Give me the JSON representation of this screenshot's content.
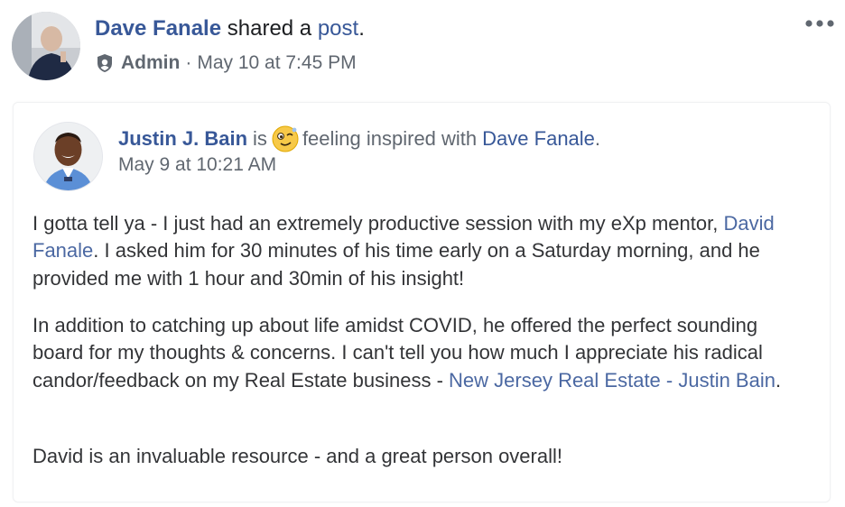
{
  "header": {
    "author": "Dave Fanale",
    "shared_text": "shared a",
    "post_link": "post",
    "period": ".",
    "role": "Admin",
    "separator": "·",
    "timestamp": "May 10 at 7:45 PM"
  },
  "shared_post": {
    "author": "Justin J. Bain",
    "is_text": "is",
    "feeling_text": "feeling inspired with",
    "tagged": "Dave Fanale",
    "period": ".",
    "timestamp": "May 9 at 10:21 AM",
    "body": {
      "p1_a": "I gotta tell ya - I just had an extremely productive session with my eXp mentor,",
      "p1_link": "David Fanale",
      "p1_b": ". I asked him for 30 minutes of his time early on a Saturday morning, and he provided me with 1 hour and 30min of his insight!",
      "p2_a": "In addition to catching up about life amidst COVID, he offered the perfect sounding board for my thoughts & concerns. I can't tell you how much I appreciate his radical candor/feedback on my Real Estate business - ",
      "p2_link": "New Jersey Real Estate - Justin Bain",
      "p2_b": ".",
      "p3": "David is an invaluable resource - and a great person overall!"
    }
  },
  "colors": {
    "link": "#385898",
    "text": "#1c1e21",
    "secondary": "#606770"
  },
  "icons": {
    "more": "more-options-icon",
    "admin": "admin-shield-icon",
    "feeling": "inspired-emoji-icon"
  }
}
